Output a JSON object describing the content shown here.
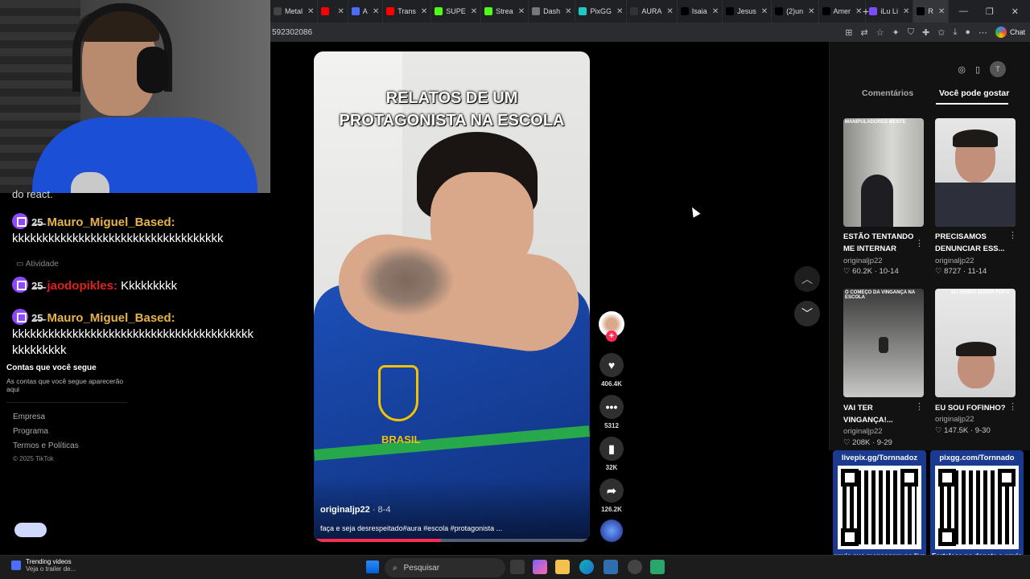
{
  "browser": {
    "tabs": [
      {
        "label": "Metal",
        "color": "#444"
      },
      {
        "label": "",
        "color": "#ff0000"
      },
      {
        "label": "A",
        "color": "#4a6fff"
      },
      {
        "label": "Trans",
        "color": "#ff0000"
      },
      {
        "label": "SUPE",
        "color": "#53fc18"
      },
      {
        "label": "Strea",
        "color": "#53fc18"
      },
      {
        "label": "Dash",
        "color": "#777"
      },
      {
        "label": "PixGG",
        "color": "#21c8c8"
      },
      {
        "label": "AURA",
        "color": "#333"
      },
      {
        "label": "Isaia",
        "color": "#000"
      },
      {
        "label": "Jesus",
        "color": "#000"
      },
      {
        "label": "(2)un",
        "color": "#000"
      },
      {
        "label": "Amer",
        "color": "#000"
      },
      {
        "label": "iLu Li",
        "color": "#7b4dff"
      },
      {
        "label": "R",
        "color": "#000"
      }
    ],
    "url": "592302086",
    "chat_label": "Chat",
    "window_controls": [
      "—",
      "❐",
      "✕"
    ]
  },
  "chat": {
    "partial_line": "do react.",
    "messages": [
      {
        "badge": "2̶5̶",
        "user": "Mauro_Miguel_Based:",
        "user_color": "#e8b24a",
        "text": "kkkkkkkkkkkkkkkkkkkkkkkkkkkkkkkkkkk"
      },
      {
        "badge": "2̶5̶",
        "user": "jaodopikles:",
        "user_color": "#e02020",
        "text": "Kkkkkkkkk"
      },
      {
        "badge": "2̶5̶",
        "user": "Mauro_Miguel_Based:",
        "user_color": "#e8b24a",
        "text": "kkkkkkkkkkkkkkkkkkkkkkkkkkkkkkkkkkkkkkkkkkkkkkkkk"
      }
    ],
    "activity_label": "Atividade"
  },
  "tiktok_sidebar": {
    "following_title": "Contas que você segue",
    "following_hint": "As contas que você segue aparecerão aqui",
    "footer_links": [
      "Empresa",
      "Programa",
      "Termos e Políticas"
    ],
    "copyright": "© 2025 TikTok"
  },
  "video": {
    "title_line1": "RELATOS DE UM",
    "title_line2": "PROTAGONISTA NA ESCOLA",
    "jersey_text": "BRASIL",
    "author": "originaljp22",
    "date": "· 8-4",
    "caption": "faça e seja desrespeitado#aura #escola #protagonista ...",
    "progress": 0.46,
    "likes": "406.4K",
    "comments": "5312",
    "saves": "32K",
    "shares": "126.2K"
  },
  "right_panel": {
    "tabs": [
      "Comentários",
      "Você pode gostar"
    ],
    "user_initial": "T",
    "recommendations": [
      {
        "title": "ESTÃO TENTANDO ME INTERNAR",
        "author": "originaljp22",
        "likes": "60.2K",
        "date": "10-14",
        "thumb_text": "MANIPULADORES MENTE"
      },
      {
        "title": "PRECISAMOS DENUNCIAR ESS...",
        "author": "originaljp22",
        "likes": "8727",
        "date": "11-14",
        "thumb_text": ""
      },
      {
        "title": "VAI TER VINGANÇA!...",
        "author": "originaljp22",
        "likes": "208K",
        "date": "9-29",
        "thumb_text": "O COMEÇO DA VINGANÇA NA ESCOLA"
      },
      {
        "title": "EU SOU FOFINHO?",
        "author": "originaljp22",
        "likes": "147.5K",
        "date": "9-30",
        "thumb_text": "EU SENDO SUPER FOFO"
      }
    ]
  },
  "overlays": {
    "livepix_url": "livepix.gg/Tornnadoz",
    "livepix_text": "envie sua mensagem na live via pix!",
    "pixgg_url": "pixgg.com/Tornnado",
    "pixgg_text": "Fortaleça no donate e envie sua mensagem!"
  },
  "taskbar": {
    "news_title": "Trending videos",
    "news_sub": "Veja o trailer de...",
    "search_placeholder": "Pesquisar"
  },
  "colors": {
    "tiktok_red": "#fe2c55",
    "twitch_purple": "#9146ff",
    "overlay_blue": "#1a3a8f"
  }
}
